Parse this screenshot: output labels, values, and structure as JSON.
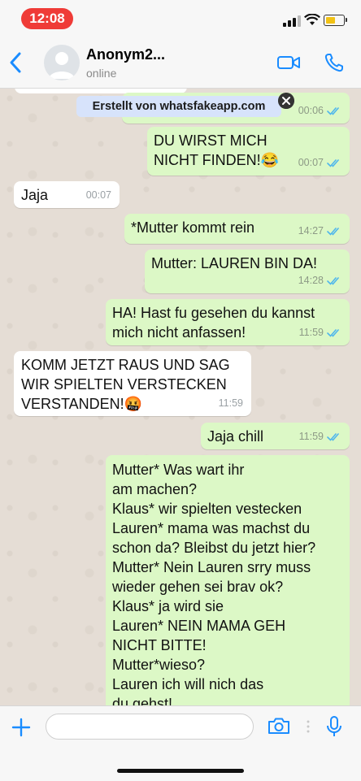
{
  "status_bar": {
    "time": "12:08"
  },
  "header": {
    "contact_name": "Anonym2...",
    "contact_status": "online"
  },
  "watermark": {
    "text": "Erstellt von whatsfakeapp.com"
  },
  "messages": [
    {
      "dir": "out",
      "text": "",
      "time": "00:06",
      "ticks": "blue"
    },
    {
      "dir": "out",
      "text": "DU WIRST MICH\nNICHT FINDEN!😂",
      "time": "00:07",
      "ticks": "blue"
    },
    {
      "dir": "in",
      "text": "Jaja",
      "time": "00:07"
    },
    {
      "dir": "out",
      "text": "*Mutter kommt rein",
      "time": "14:27",
      "ticks": "blue"
    },
    {
      "dir": "out",
      "text": "Mutter: LAUREN BIN DA!",
      "time": "14:28",
      "ticks": "blue"
    },
    {
      "dir": "out",
      "text": "HA! Hast fu gesehen du kannst\nmich nicht anfassen!",
      "time": "11:59",
      "ticks": "blue"
    },
    {
      "dir": "in",
      "text": "KOMM JETZT RAUS UND SAG\nWIR SPIELTEN VERSTECKEN\nVERSTANDEN!🤬",
      "time": "11:59"
    },
    {
      "dir": "out",
      "text": "Jaja chill",
      "time": "11:59",
      "ticks": "blue"
    },
    {
      "dir": "out",
      "text": "Mutter* Was wart ihr\nam machen?\nKlaus* wir spielten vestecken\nLauren* mama was machst du\nschon da? Bleibst du jetzt hier?\nMutter* Nein Lauren srry muss\nwieder gehen sei brav ok?\nKlaus* ja wird sie\nLauren* NEIN MAMA GEH\nNICHT BITTE!\nMutter*wieso?\nLauren ich will nich das\ndu gehst!\nMutter* nein schätzchen, Klaus",
      "time": "",
      "ticks": ""
    }
  ],
  "input": {
    "placeholder": ""
  },
  "colors": {
    "outgoing": "#dcf8c6",
    "incoming": "#ffffff",
    "accent": "#1a8cff",
    "time_pill": "#ef3b37",
    "read_ticks": "#4fb6ec"
  },
  "icons": [
    "back-chevron-icon",
    "avatar-placeholder-icon",
    "video-call-icon",
    "phone-icon",
    "plus-icon",
    "camera-icon",
    "more-dots-icon",
    "microphone-icon",
    "close-icon",
    "double-check-icon"
  ]
}
